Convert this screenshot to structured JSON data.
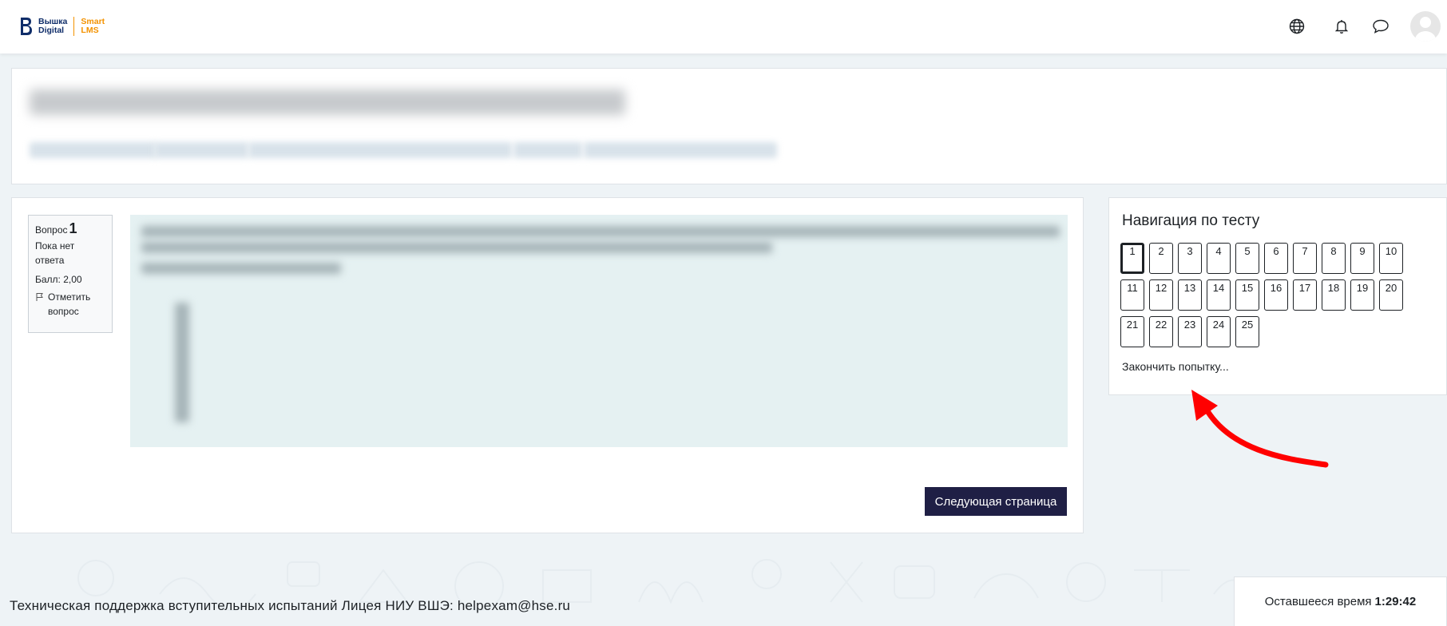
{
  "navbar": {
    "logo": {
      "line1": "Вышка",
      "line2": "Digital",
      "line3": "Smart",
      "line4": "LMS"
    },
    "icons": [
      "globe-icon",
      "bell-icon",
      "chat-icon"
    ],
    "colors": {
      "logo_blue": "#0f2d69",
      "logo_orange": "#f39200"
    }
  },
  "question": {
    "number_label": "Вопрос",
    "number": "1",
    "status_line1": "Пока нет",
    "status_line2": "ответа",
    "score": "Балл: 2,00",
    "flag_line1": "Отметить",
    "flag_line2": "вопрос",
    "next_button": "Следующая страница"
  },
  "quiz_nav": {
    "title": "Навигация по тесту",
    "current": "1",
    "buttons": [
      "1",
      "2",
      "3",
      "4",
      "5",
      "6",
      "7",
      "8",
      "9",
      "10",
      "11",
      "12",
      "13",
      "14",
      "15",
      "16",
      "17",
      "18",
      "19",
      "20",
      "21",
      "22",
      "23",
      "24",
      "25"
    ],
    "finish_link": "Закончить попытку..."
  },
  "footer": {
    "support_text": "Техническая поддержка вступительных испытаний Лицея НИУ ВШЭ: helpexam@hse.ru"
  },
  "timer": {
    "label": "Оставшееся время",
    "value": "1:29:42"
  },
  "colors": {
    "page_bg": "#eef3f6",
    "primary_button": "#1f1f45",
    "question_bg": "#e5f1f2",
    "annotation_arrow": "#ff0000"
  }
}
